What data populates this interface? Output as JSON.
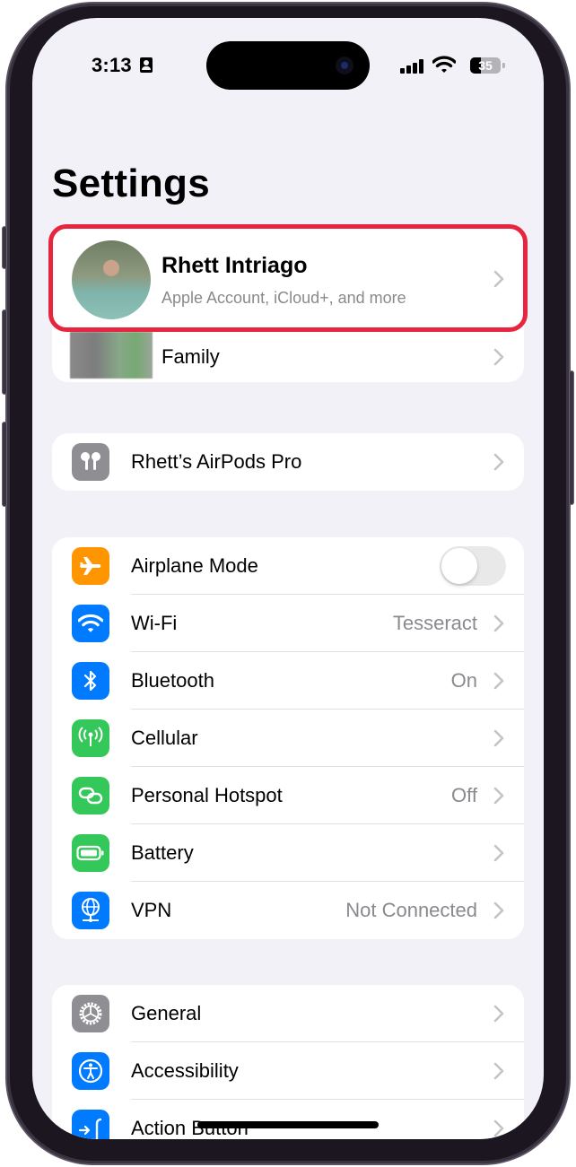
{
  "status_bar": {
    "time": "3:13",
    "focus_icon": "person-badge-icon",
    "signal_icon": "cellular-signal-icon",
    "wifi_icon": "wifi-icon",
    "battery_percent": "35",
    "battery_level": 0.35
  },
  "page": {
    "title": "Settings"
  },
  "profile": {
    "name": "Rhett Intriago",
    "subtitle": "Apple Account, iCloud+, and more",
    "family_label": "Family",
    "highlight_color": "#e8253f"
  },
  "airpods": {
    "label": "Rhett’s AirPods Pro",
    "icon": "airpods-icon",
    "icon_color": "#8e8e93"
  },
  "connectivity": [
    {
      "label": "Airplane Mode",
      "icon": "airplane-icon",
      "icon_color": "#ff9500",
      "toggle": false
    },
    {
      "label": "Wi-Fi",
      "icon": "wifi-icon",
      "icon_color": "#007aff",
      "value": "Tesseract"
    },
    {
      "label": "Bluetooth",
      "icon": "bluetooth-icon",
      "icon_color": "#007aff",
      "value": "On"
    },
    {
      "label": "Cellular",
      "icon": "antenna-icon",
      "icon_color": "#34c759",
      "value": ""
    },
    {
      "label": "Personal Hotspot",
      "icon": "hotspot-link-icon",
      "icon_color": "#34c759",
      "value": "Off"
    },
    {
      "label": "Battery",
      "icon": "battery-icon",
      "icon_color": "#34c759",
      "value": ""
    },
    {
      "label": "VPN",
      "icon": "globe-network-icon",
      "icon_color": "#007aff",
      "value": "Not Connected"
    }
  ],
  "general": [
    {
      "label": "General",
      "icon": "gear-icon",
      "icon_color": "#8e8e93"
    },
    {
      "label": "Accessibility",
      "icon": "accessibility-icon",
      "icon_color": "#007aff"
    },
    {
      "label": "Action Button",
      "icon": "action-button-icon",
      "icon_color": "#007aff"
    }
  ]
}
